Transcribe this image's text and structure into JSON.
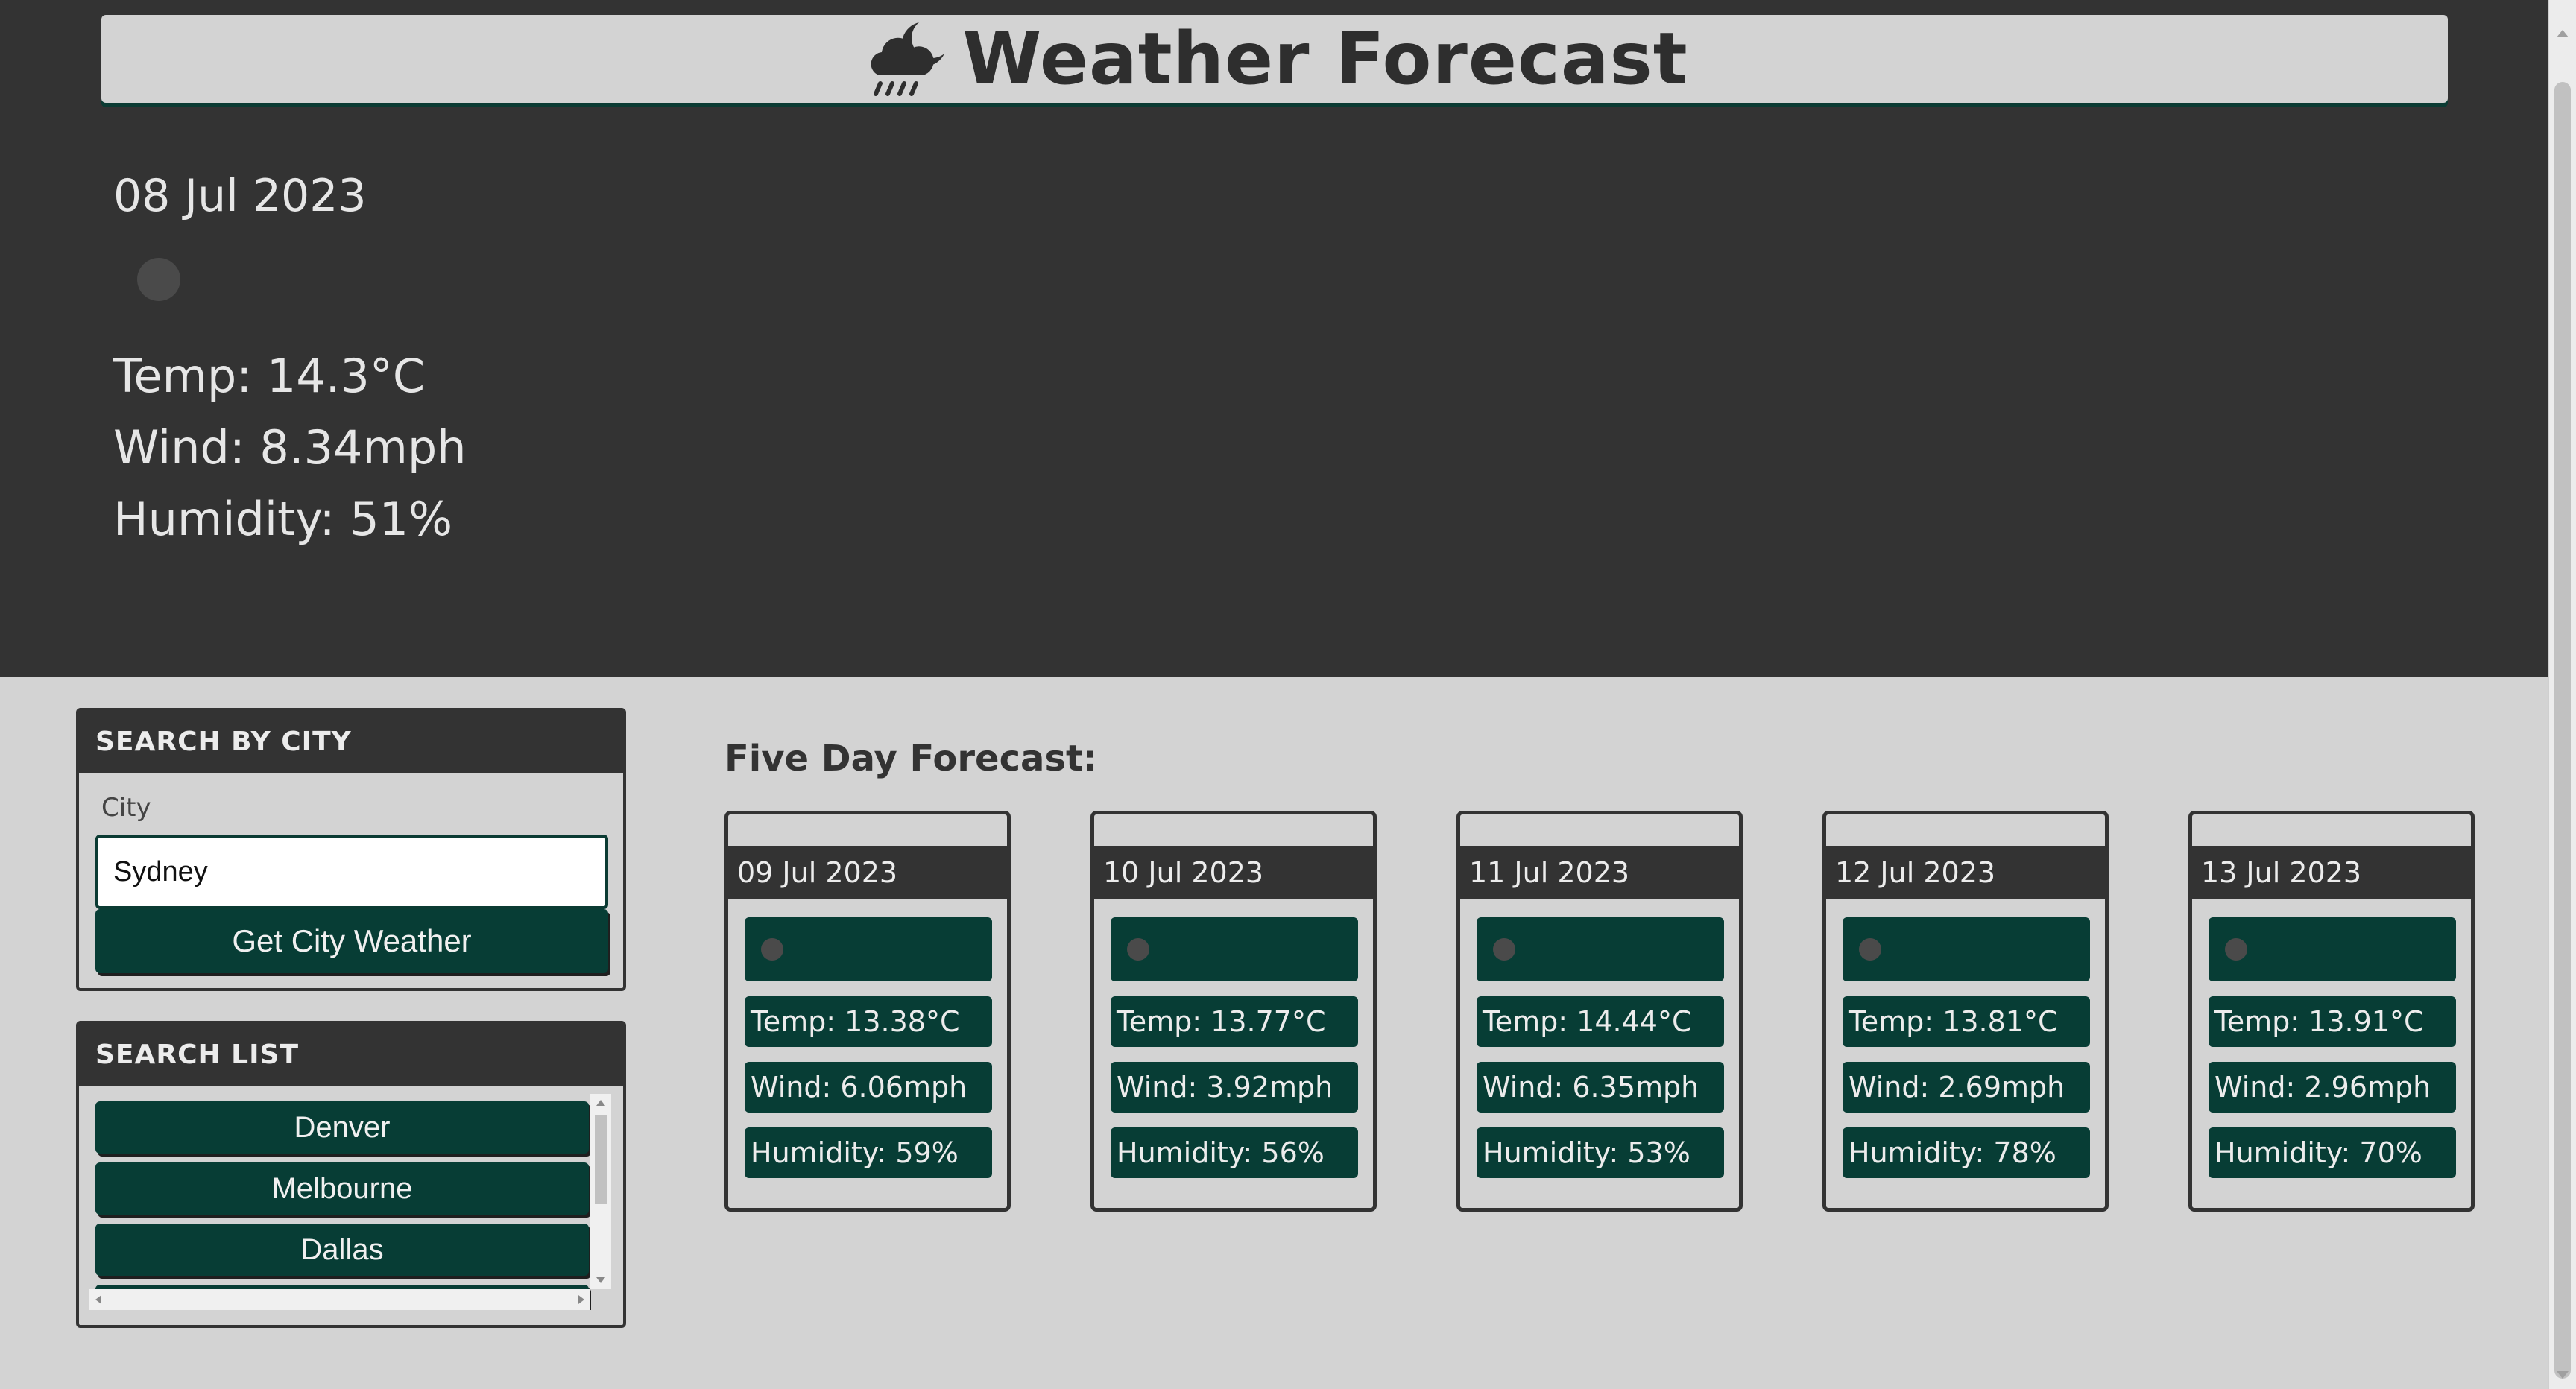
{
  "header": {
    "title": "Weather Forecast",
    "icon": "cloud-moon-rain-icon"
  },
  "current": {
    "date": "08 Jul 2023",
    "temp": "Temp: 14.3°C",
    "wind": "Wind: 8.34mph",
    "humidity": "Humidity: 51%"
  },
  "search": {
    "heading": "SEARCH BY CITY",
    "label": "City",
    "value": "Sydney",
    "button": "Get City Weather"
  },
  "search_list": {
    "heading": "SEARCH LIST",
    "items": [
      "Denver",
      "Melbourne",
      "Dallas",
      ""
    ]
  },
  "forecast": {
    "title": "Five Day Forecast:",
    "days": [
      {
        "date": "09 Jul 2023",
        "temp": "Temp: 13.38°C",
        "wind": "Wind: 6.06mph",
        "humidity": "Humidity: 59%"
      },
      {
        "date": "10 Jul 2023",
        "temp": "Temp: 13.77°C",
        "wind": "Wind: 3.92mph",
        "humidity": "Humidity: 56%"
      },
      {
        "date": "11 Jul 2023",
        "temp": "Temp: 14.44°C",
        "wind": "Wind: 6.35mph",
        "humidity": "Humidity: 53%"
      },
      {
        "date": "12 Jul 2023",
        "temp": "Temp: 13.81°C",
        "wind": "Wind: 2.69mph",
        "humidity": "Humidity: 78%"
      },
      {
        "date": "13 Jul 2023",
        "temp": "Temp: 13.91°C",
        "wind": "Wind: 2.96mph",
        "humidity": "Humidity: 70%"
      }
    ]
  },
  "colors": {
    "dark": "#333333",
    "accent": "#073d35",
    "light": "#d3d3d3"
  }
}
